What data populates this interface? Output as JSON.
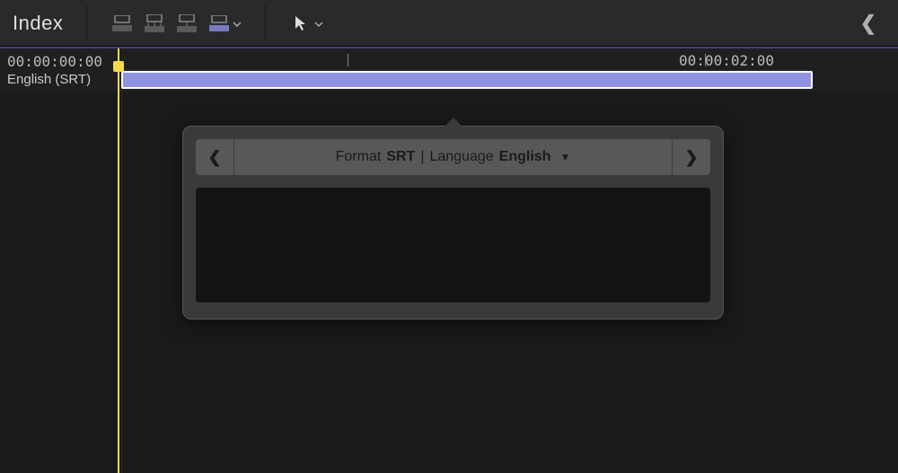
{
  "toolbar": {
    "index_label": "Index"
  },
  "timeline": {
    "start_timecode": "00:00:00:00",
    "end_timecode": "00:00:02:00",
    "track_label": "English (SRT)"
  },
  "popover": {
    "format_label": "Format",
    "format_value": "SRT",
    "separator": "|",
    "language_label": "Language",
    "language_value": "English"
  }
}
